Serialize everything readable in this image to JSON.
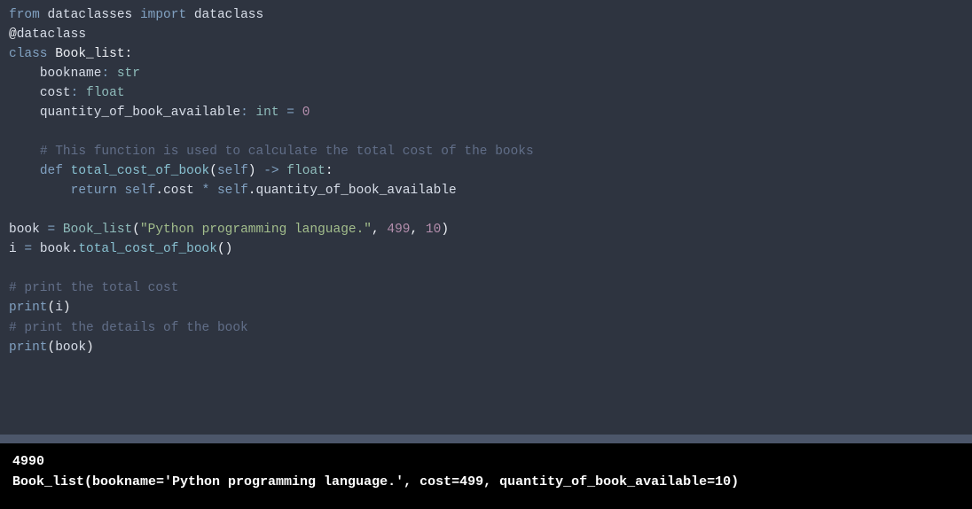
{
  "code": {
    "l1": {
      "kw1": "from",
      "mod": "dataclasses",
      "kw2": "import",
      "name": "dataclass"
    },
    "l2": {
      "at": "@",
      "dec": "dataclass"
    },
    "l3": {
      "kw": "class",
      "cls": "Book_list",
      "colon": ":"
    },
    "l4": {
      "field": "bookname",
      "colon": ":",
      "type": "str"
    },
    "l5": {
      "field": "cost",
      "colon": ":",
      "type": "float"
    },
    "l6": {
      "field": "quantity_of_book_available",
      "colon": ":",
      "type": "int",
      "eq": "=",
      "val": "0"
    },
    "l8": {
      "comment": "# This function is used to calculate the total cost of the books"
    },
    "l9": {
      "kw": "def",
      "fn": "total_cost_of_book",
      "lp": "(",
      "self": "self",
      "rp": ")",
      "arrow": "->",
      "type": "float",
      "colon": ":"
    },
    "l10": {
      "kw": "return",
      "self": "self",
      "dot1": ".",
      "attr1": "cost",
      "op": "*",
      "self2": "self",
      "dot2": ".",
      "attr2": "quantity_of_book_available"
    },
    "l12": {
      "var": "book",
      "eq": "=",
      "cls": "Book_list",
      "lp": "(",
      "str": "\"Python programming language.\"",
      "c1": ",",
      "n1": "499",
      "c2": ",",
      "n2": "10",
      "rp": ")"
    },
    "l13": {
      "var": "i",
      "eq": "=",
      "obj": "book",
      "dot": ".",
      "fn": "total_cost_of_book",
      "lp": "(",
      "rp": ")"
    },
    "l15": {
      "comment": "# print the total cost"
    },
    "l16": {
      "fn": "print",
      "lp": "(",
      "arg": "i",
      "rp": ")"
    },
    "l17": {
      "comment": "# print the details of the book"
    },
    "l18": {
      "fn": "print",
      "lp": "(",
      "arg": "book",
      "rp": ")"
    }
  },
  "output": {
    "line1": "4990",
    "line2": "Book_list(bookname='Python programming language.', cost=499, quantity_of_book_available=10)"
  }
}
